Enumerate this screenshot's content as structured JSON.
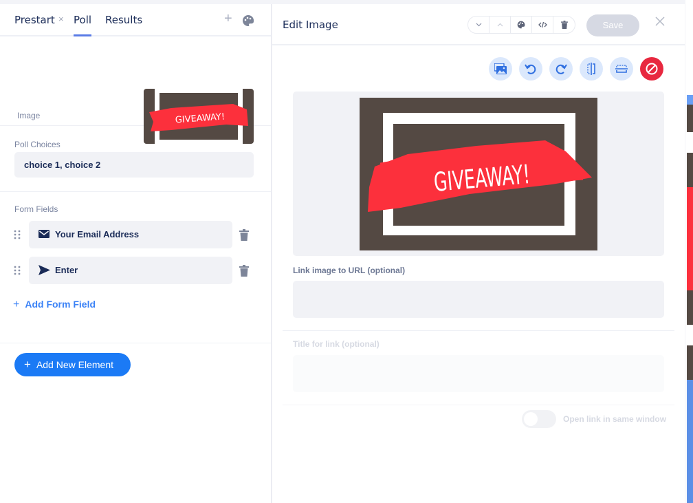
{
  "left_panel": {
    "tabs": [
      {
        "label": "Prestart",
        "closable": true,
        "active": false
      },
      {
        "label": "Poll",
        "active": true
      },
      {
        "label": "Results",
        "active": false
      }
    ],
    "tab_close_glyph": "×",
    "add_tab_glyph": "+",
    "palette_icon": "palette-icon",
    "image_section": {
      "label": "Image",
      "thumbnail_text": "GIVEAWAY!"
    },
    "poll_choices": {
      "label": "Poll Choices",
      "value": "choice 1, choice 2"
    },
    "form_fields": {
      "label": "Form Fields",
      "items": [
        {
          "icon": "envelope-icon",
          "label": "Your Email Address"
        },
        {
          "icon": "send-icon",
          "label": "Enter"
        }
      ],
      "add_label": "Add Form Field",
      "add_glyph": "+"
    },
    "add_element": {
      "label": "Add New Element",
      "glyph": "+"
    }
  },
  "edit_panel": {
    "title": "Edit Image",
    "header_buttons": [
      "chevron-down-icon",
      "chevron-up-icon",
      "palette-icon",
      "code-icon",
      "trash-icon"
    ],
    "save_label": "Save",
    "toolbar": [
      "image-gallery-icon",
      "rotate-left-icon",
      "rotate-right-icon",
      "flip-horizontal-icon",
      "flip-vertical-icon",
      "remove-icon"
    ],
    "preview_text": "GIVEAWAY!",
    "link_url": {
      "label": "Link image to URL (optional)",
      "value": ""
    },
    "link_title": {
      "label": "Title for link (optional)",
      "value": ""
    },
    "open_same_window": {
      "label": "Open link in same window",
      "enabled": false
    }
  },
  "colors": {
    "accent": "#1b7af5",
    "link_blue": "#3b82f6",
    "danger": "#e8283f",
    "text_dark": "#1a2b57",
    "image_brown": "#544943",
    "image_red": "#fc303c"
  }
}
